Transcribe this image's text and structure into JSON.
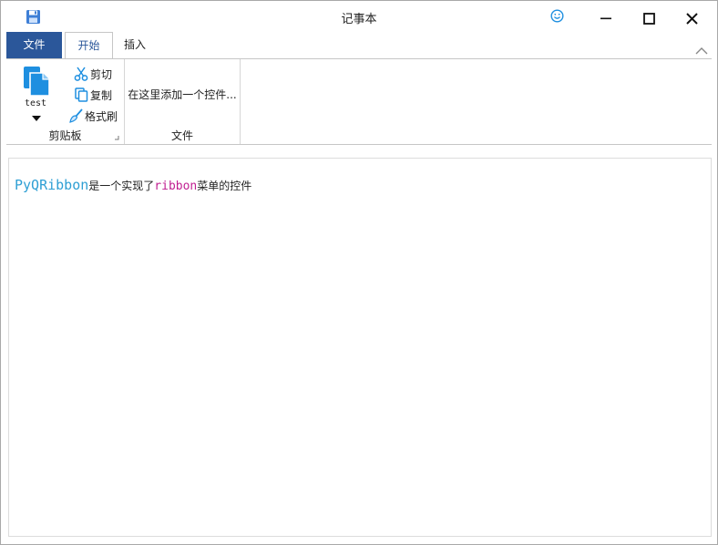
{
  "window": {
    "title": "记事本",
    "icons": {
      "save": "save-icon",
      "smiley": "smiley-icon",
      "minimize": "minimize-icon",
      "maximize": "maximize-icon",
      "close": "close-icon"
    }
  },
  "tabs": [
    {
      "label": "文件",
      "state": "application-menu"
    },
    {
      "label": "开始",
      "state": "selected"
    },
    {
      "label": "插入",
      "state": "normal"
    }
  ],
  "ribbon": {
    "clipboard": {
      "label": "剪贴板",
      "big_button": {
        "label": "test",
        "icon": "document-icon"
      },
      "cut": "剪切",
      "copy": "复制",
      "format_painter": "格式刷"
    },
    "file": {
      "label": "文件",
      "placeholder": "在这里添加一个控件..."
    }
  },
  "editor": {
    "segments": [
      {
        "text": "PyQRibbon",
        "style": "brand"
      },
      {
        "text": "是一个实现了",
        "style": "normal"
      },
      {
        "text": "ribbon",
        "style": "accent"
      },
      {
        "text": "菜单的控件",
        "style": "normal"
      }
    ],
    "colors": {
      "brand": "#2e9fd4",
      "accent": "#c01f91",
      "file_tab": "#2b579a"
    }
  }
}
